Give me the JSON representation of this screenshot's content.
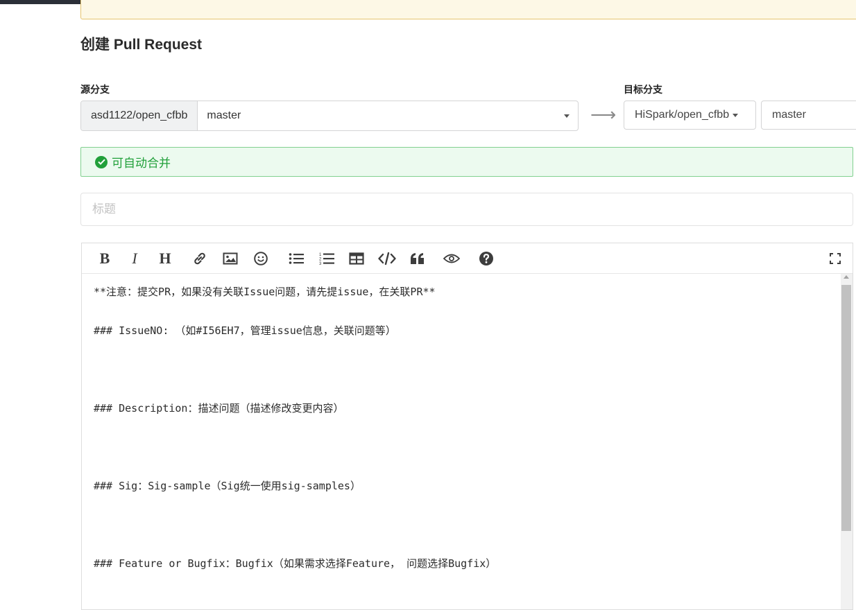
{
  "page": {
    "title": "创建 Pull Request"
  },
  "source": {
    "label": "源分支",
    "repo": "asd1122/open_cfbb",
    "branch": "master"
  },
  "target": {
    "label": "目标分支",
    "repo": "HiSpark/open_cfbb",
    "branch": "master"
  },
  "merge_status": {
    "text": "可自动合并",
    "color": "#21a03a"
  },
  "title_input": {
    "placeholder": "标题",
    "value": ""
  },
  "toolbar": {
    "items": [
      "bold-icon",
      "italic-icon",
      "heading-icon",
      "link-icon",
      "image-icon",
      "emoji-icon",
      "unordered-list-icon",
      "ordered-list-icon",
      "table-icon",
      "code-icon",
      "quote-icon",
      "preview-icon",
      "help-icon",
      "fullscreen-icon"
    ],
    "bold": "B",
    "italic": "I",
    "heading": "H"
  },
  "editor": {
    "lines": [
      "**注意：提交PR，如果没有关联Issue问题，请先提issue，在关联PR**",
      "### IssueNO: （如#I56EH7，管理issue信息，关联问题等）",
      "### Description：描述问题（描述修改变更内容）",
      "### Sig：Sig-sample（Sig统一使用sig-samples）",
      "### Feature or Bugfix：Bugfix（如果需求选择Feature， 问题选择Bugfix）"
    ]
  }
}
